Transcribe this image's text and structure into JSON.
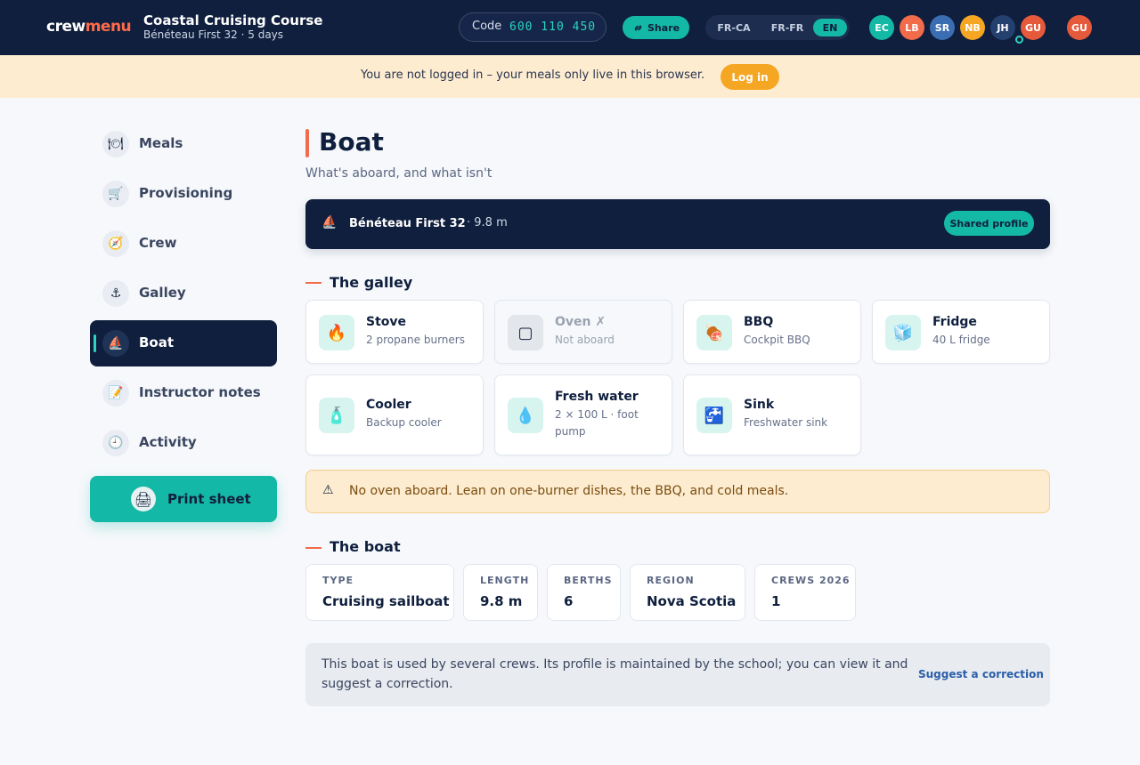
{
  "header": {
    "logo_part1": "crew",
    "logo_part2": "menu",
    "course_title": "Coastal Cruising Course",
    "course_subtitle": "Bénéteau First 32 · 5 days",
    "code_label": "Code",
    "code_value": "600 110 450",
    "share_label": "Share",
    "languages": [
      {
        "label": "FR-CA",
        "active": false
      },
      {
        "label": "FR-FR",
        "active": false
      },
      {
        "label": "EN",
        "active": true
      }
    ],
    "avatars": [
      {
        "initials": "EC",
        "color": "#14b8a6"
      },
      {
        "initials": "LB",
        "color": "#f26b4a"
      },
      {
        "initials": "SR",
        "color": "#3b6db3"
      },
      {
        "initials": "NB",
        "color": "#f5a623"
      },
      {
        "initials": "JH",
        "color": "#24406e"
      },
      {
        "initials": "GU",
        "color": "#e65a3c"
      }
    ],
    "current_user": {
      "initials": "GU",
      "color": "#e65a3c"
    }
  },
  "banner": {
    "text": "You are not logged in – your meals only live in this browser.",
    "login_label": "Log in"
  },
  "sidebar": {
    "items": [
      {
        "label": "Meals",
        "icon": "🍽"
      },
      {
        "label": "Provisioning",
        "icon": "🛒"
      },
      {
        "label": "Crew",
        "icon": "🧭"
      },
      {
        "label": "Galley",
        "icon": "⚓"
      },
      {
        "label": "Boat",
        "icon": "⛵"
      },
      {
        "label": "Instructor notes",
        "icon": "📝"
      },
      {
        "label": "Activity",
        "icon": "🕘"
      }
    ],
    "active_index": 4,
    "print_label": "Print sheet",
    "print_icon": "🖨"
  },
  "main": {
    "title": "Boat",
    "subtitle": "What's aboard, and what isn't",
    "boat": {
      "icon": "⛵",
      "name": "Bénéteau First 32",
      "length": "· 9.8 m",
      "badge": "Shared profile"
    },
    "galley_title": "The galley",
    "galley": [
      {
        "title": "Stove",
        "subtitle": "2 propane burners",
        "icon": "🔥",
        "aboard": true
      },
      {
        "title": "Oven ✗",
        "subtitle": "Not aboard",
        "icon": "▢",
        "aboard": false
      },
      {
        "title": "BBQ",
        "subtitle": "Cockpit BBQ",
        "icon": "🍖",
        "aboard": true
      },
      {
        "title": "Fridge",
        "subtitle": "40 L fridge",
        "icon": "🧊",
        "aboard": true
      },
      {
        "title": "Cooler",
        "subtitle": "Backup cooler",
        "icon": "🧴",
        "aboard": true
      },
      {
        "title": "Fresh water",
        "subtitle": "2 × 100 L · foot pump",
        "icon": "💧",
        "aboard": true
      },
      {
        "title": "Sink",
        "subtitle": "Freshwater sink",
        "icon": "🚰",
        "aboard": true
      }
    ],
    "warning": {
      "icon": "⚠",
      "text": "No oven aboard. Lean on one-burner dishes, the BBQ, and cold meals."
    },
    "boat_title": "The boat",
    "specs": [
      {
        "label": "TYPE",
        "value": "Cruising sailboat"
      },
      {
        "label": "LENGTH",
        "value": "9.8 m"
      },
      {
        "label": "BERTHS",
        "value": "6"
      },
      {
        "label": "REGION",
        "value": "Nova Scotia"
      },
      {
        "label": "CREWS 2026",
        "value": "1"
      }
    ],
    "info": {
      "text": "This boat is used by several crews. Its profile is maintained by the school; you can view it and suggest a correction.",
      "link": "Suggest a correction"
    }
  }
}
